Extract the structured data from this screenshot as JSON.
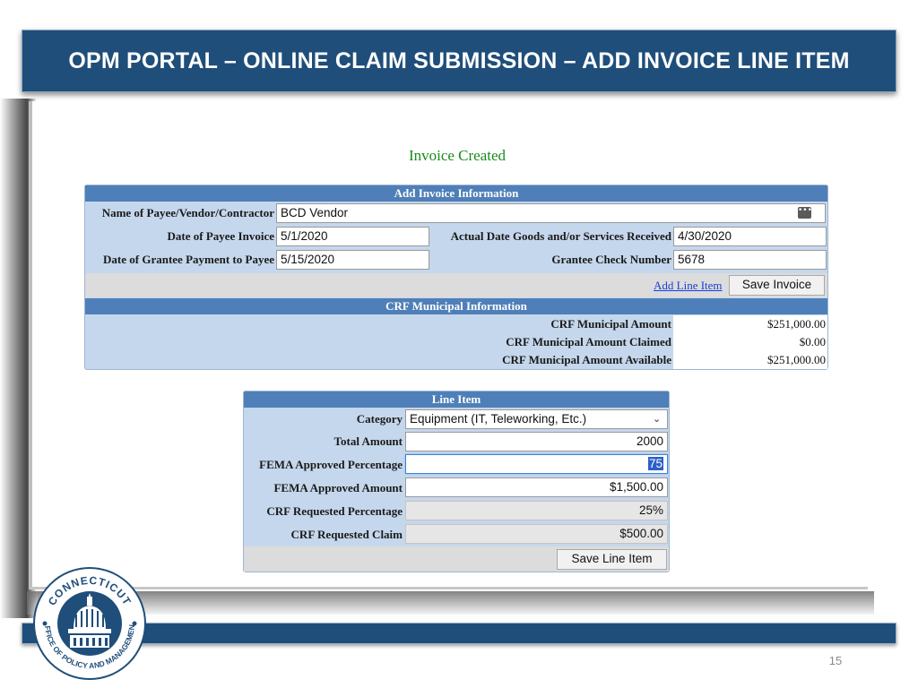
{
  "slide": {
    "title": "OPM PORTAL – ONLINE CLAIM SUBMISSION – ADD INVOICE LINE ITEM",
    "page_number": "15",
    "seal": {
      "top_text": "CONNECTICUT",
      "bottom_text": "OFFICE OF POLICY AND MANAGEMENT"
    }
  },
  "status_message": "Invoice Created",
  "invoice": {
    "header": "Add Invoice Information",
    "payee_label": "Name of Payee/Vendor/Contractor",
    "payee_value": "BCD Vendor",
    "invoice_date_label": "Date of Payee Invoice",
    "invoice_date_value": "5/1/2020",
    "goods_date_label": "Actual Date Goods and/or Services Received",
    "goods_date_value": "4/30/2020",
    "payment_date_label": "Date of Grantee Payment to Payee",
    "payment_date_value": "5/15/2020",
    "check_label": "Grantee Check Number",
    "check_value": "5678",
    "add_line_link": "Add Line Item",
    "save_button": "Save Invoice"
  },
  "crf": {
    "header": "CRF Municipal Information",
    "rows": [
      {
        "label": "CRF Municipal Amount",
        "value": "$251,000.00"
      },
      {
        "label": "CRF Municipal Amount Claimed",
        "value": "$0.00"
      },
      {
        "label": "CRF Municipal Amount Available",
        "value": "$251,000.00"
      }
    ]
  },
  "line_item": {
    "header": "Line Item",
    "category_label": "Category",
    "category_value": "Equipment (IT, Teleworking, Etc.)",
    "total_label": "Total Amount",
    "total_value": "2000",
    "fema_pct_label": "FEMA Approved Percentage",
    "fema_pct_value": "75",
    "fema_amt_label": "FEMA Approved Amount",
    "fema_amt_value": "$1,500.00",
    "crf_pct_label": "CRF Requested Percentage",
    "crf_pct_value": "25%",
    "crf_claim_label": "CRF Requested Claim",
    "crf_claim_value": "$500.00",
    "save_button": "Save Line Item"
  },
  "colors": {
    "banner": "#1f4e7a",
    "panel_header": "#4f7fb8",
    "panel_body": "#c5d7ec",
    "status_green": "#1a8a1a",
    "link_blue": "#1a3fd8"
  }
}
